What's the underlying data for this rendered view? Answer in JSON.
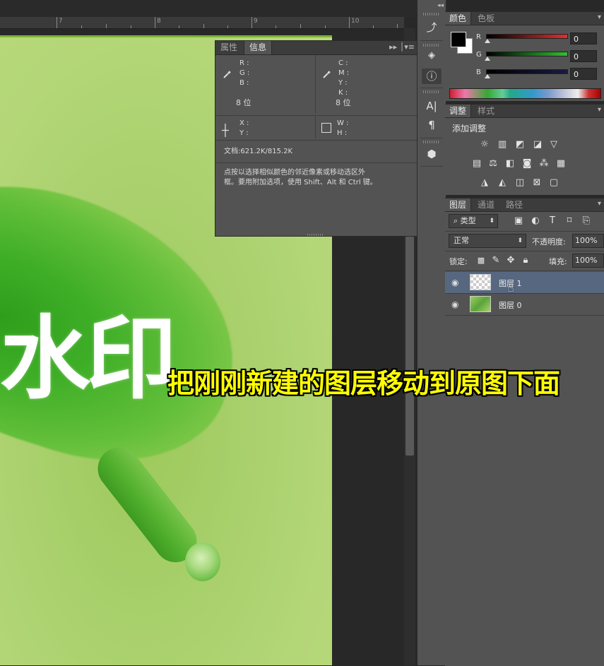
{
  "ruler": {
    "marks": [
      "7",
      "8",
      "9",
      "10"
    ]
  },
  "canvas": {
    "watermark_text": "水印"
  },
  "info_panel": {
    "tabs": [
      "属性",
      "信息"
    ],
    "active_tab": "信息",
    "rgb_labels": [
      "R :",
      "G :",
      "B :"
    ],
    "cmyk_labels": [
      "C :",
      "M :",
      "Y :",
      "K :"
    ],
    "bit_left": "8 位",
    "bit_right": "8 位",
    "xy_labels": [
      "X :",
      "Y :"
    ],
    "wh_labels": [
      "W :",
      "H :"
    ],
    "doc_info": "文档:621.2K/815.2K",
    "hint_line1": "点按以选择相似颜色的邻近像素或移动选区外",
    "hint_line2": "框。要用附加选项，使用 Shift、Alt 和 Ctrl 键。"
  },
  "color_panel": {
    "tabs": [
      "颜色",
      "色板"
    ],
    "sliders": [
      {
        "label": "R",
        "value": "0",
        "color": "#c83030"
      },
      {
        "label": "G",
        "value": "0",
        "color": "#30a030"
      },
      {
        "label": "B",
        "value": "0",
        "color": "#2a2a2a"
      }
    ]
  },
  "adjust_panel": {
    "tabs": [
      "调整",
      "样式"
    ],
    "title": "添加调整"
  },
  "layers_panel": {
    "tabs": [
      "图层",
      "通道",
      "路径"
    ],
    "filter_label": "类型",
    "blend_mode": "正常",
    "opacity_label": "不透明度:",
    "opacity_value": "100%",
    "lock_label": "锁定:",
    "fill_label": "填充:",
    "fill_value": "100%",
    "layers": [
      {
        "name": "图层 1",
        "selected": true
      },
      {
        "name": "图层 0",
        "selected": false
      }
    ]
  },
  "caption": "把刚刚新建的图层移动到原图下面"
}
